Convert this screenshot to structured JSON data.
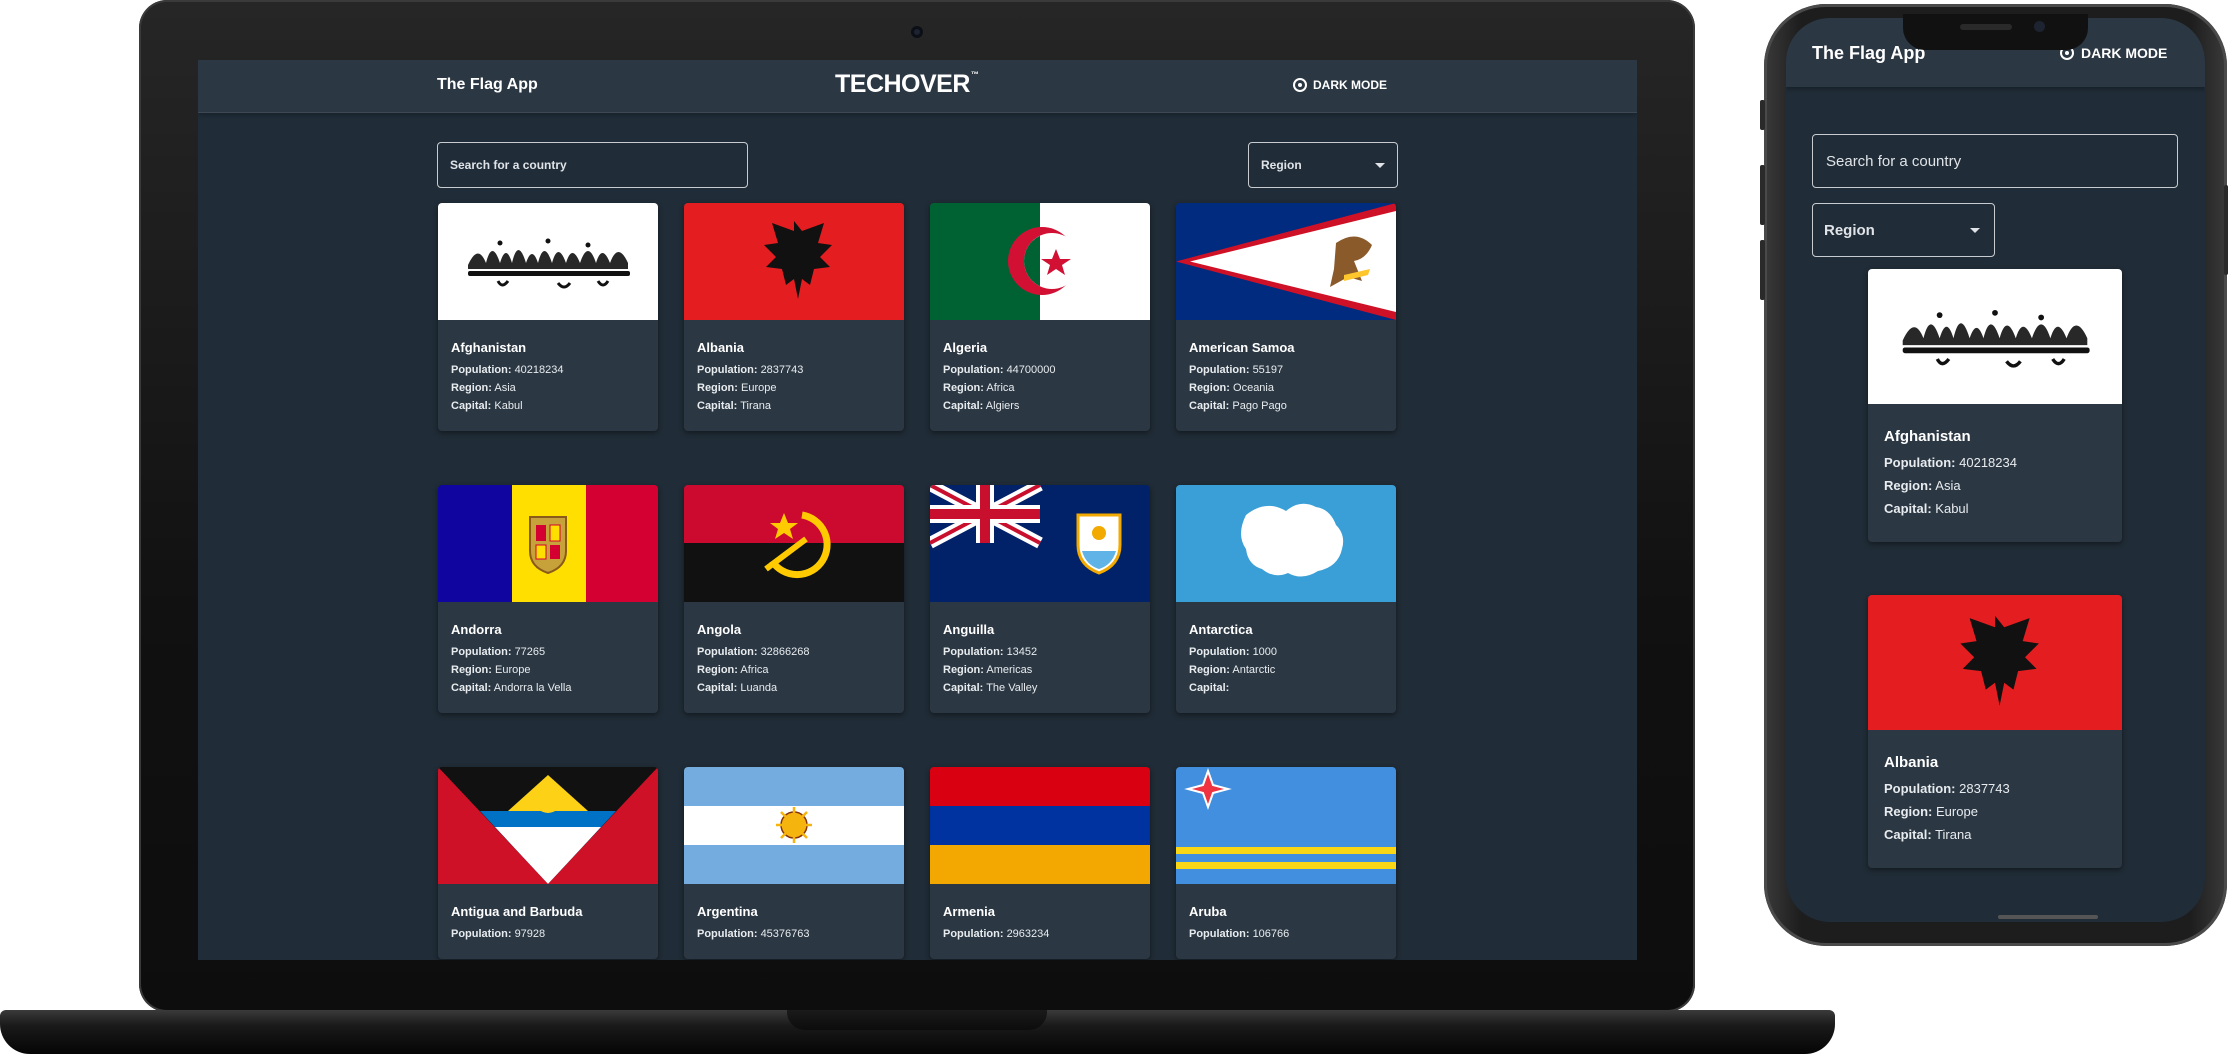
{
  "brand": {
    "logo_text": "TECHOVER",
    "logo_mark": "™"
  },
  "app": {
    "title": "The Flag App",
    "dark_mode_label": "DARK MODE",
    "search_placeholder": "Search for a country",
    "region_label": "Region"
  },
  "labels": {
    "population": "Population:",
    "region": "Region:",
    "capital": "Capital:"
  },
  "countries": [
    {
      "name": "Afghanistan",
      "population": "40218234",
      "region": "Asia",
      "capital": "Kabul",
      "flag_icon": "afghanistan-flag-icon"
    },
    {
      "name": "Albania",
      "population": "2837743",
      "region": "Europe",
      "capital": "Tirana",
      "flag_icon": "albania-flag-icon"
    },
    {
      "name": "Algeria",
      "population": "44700000",
      "region": "Africa",
      "capital": "Algiers",
      "flag_icon": "algeria-flag-icon"
    },
    {
      "name": "American Samoa",
      "population": "55197",
      "region": "Oceania",
      "capital": "Pago Pago",
      "flag_icon": "american-samoa-flag-icon"
    },
    {
      "name": "Andorra",
      "population": "77265",
      "region": "Europe",
      "capital": "Andorra la Vella",
      "flag_icon": "andorra-flag-icon"
    },
    {
      "name": "Angola",
      "population": "32866268",
      "region": "Africa",
      "capital": "Luanda",
      "flag_icon": "angola-flag-icon"
    },
    {
      "name": "Anguilla",
      "population": "13452",
      "region": "Americas",
      "capital": "The Valley",
      "flag_icon": "anguilla-flag-icon"
    },
    {
      "name": "Antarctica",
      "population": "1000",
      "region": "Antarctic",
      "capital": "",
      "flag_icon": "antarctica-flag-icon"
    },
    {
      "name": "Antigua and Barbuda",
      "population": "97928",
      "flag_icon": "antigua-and-barbuda-flag-icon"
    },
    {
      "name": "Argentina",
      "population": "45376763",
      "flag_icon": "argentina-flag-icon"
    },
    {
      "name": "Armenia",
      "population": "2963234",
      "flag_icon": "armenia-flag-icon"
    },
    {
      "name": "Aruba",
      "population": "106766",
      "flag_icon": "aruba-flag-icon"
    }
  ],
  "colors": {
    "background": "#202c37",
    "element": "#2b3743",
    "text": "#ffffff"
  }
}
